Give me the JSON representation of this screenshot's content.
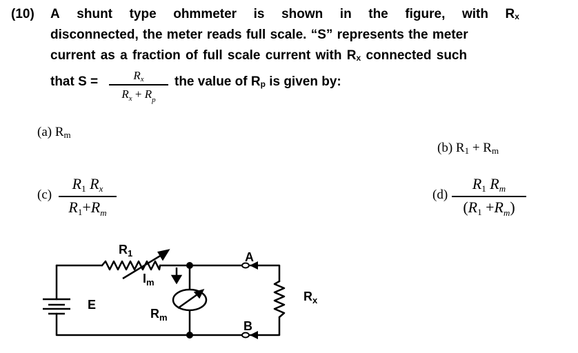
{
  "question": {
    "number": "(10)",
    "line1_words": [
      "A",
      "shunt",
      "type",
      "ohmmeter",
      "is",
      "shown",
      "in",
      "the",
      "figure,",
      "with",
      "R"
    ],
    "line1_sub": "x",
    "line2": "disconnected, the meter reads full scale. “S” represents the meter",
    "line3_pre": "current as a fraction of full scale current with R",
    "line3_sub": "x",
    "line3_post": " connected such",
    "line4_pre": "that S =",
    "line4_post_pre": "the value of R",
    "line4_post_sub": "p",
    "line4_post": " is given by:",
    "formula": {
      "numerator": "R",
      "numerator_sub": "x",
      "denominator_a": "R",
      "denominator_a_sub": "x",
      "denominator_op": "+",
      "denominator_b": "R",
      "denominator_b_sub": "p"
    }
  },
  "options": {
    "a": {
      "label": "(a) R",
      "sub": "m"
    },
    "b": {
      "label": "(b) R",
      "sub1": "1",
      "mid": " + R",
      "sub2": "m"
    },
    "c": {
      "label": "(c)",
      "num_a": "R",
      "num_a_sub": "1",
      "num_b": "R",
      "num_b_sub": "x",
      "den_a": "R",
      "den_a_sub": "1",
      "den_op": "+",
      "den_b": "R",
      "den_b_sub": "m"
    },
    "d": {
      "label": "(d)",
      "num_a": "R",
      "num_a_sub": "1",
      "num_b": "R",
      "num_b_sub": "m",
      "den_open": "(",
      "den_a": "R",
      "den_a_sub": "1",
      "den_op": "+",
      "den_b": "R",
      "den_b_sub": "m",
      "den_close": ")"
    }
  },
  "circuit": {
    "labels": {
      "r1": "R",
      "r1_sub": "1",
      "im": "I",
      "im_sub": "m",
      "rm": "R",
      "rm_sub": "m",
      "e": "E",
      "a": "A",
      "b": "B",
      "rx": "R",
      "rx_sub": "x"
    }
  }
}
